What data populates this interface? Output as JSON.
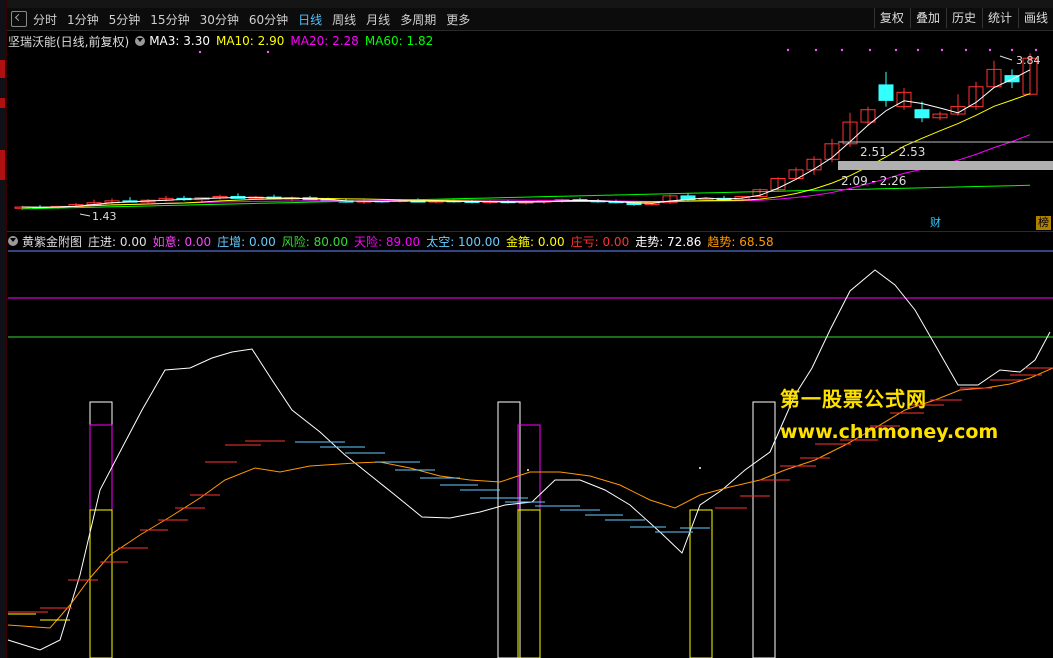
{
  "toolbar": {
    "periods": [
      "分时",
      "1分钟",
      "5分钟",
      "15分钟",
      "30分钟",
      "60分钟",
      "日线",
      "周线",
      "月线",
      "多周期",
      "更多"
    ],
    "active_period": "日线",
    "right_buttons": [
      "复权",
      "叠加",
      "历史",
      "统计",
      "画线"
    ]
  },
  "main_panel": {
    "title": "坚瑞沃能(日线,前复权)",
    "indicators": [
      {
        "label": "MA3: 3.30",
        "color": "#ffffff"
      },
      {
        "label": "MA10: 2.90",
        "color": "#ffff00"
      },
      {
        "label": "MA20: 2.28",
        "color": "#ff00ff"
      },
      {
        "label": "MA60: 1.82",
        "color": "#00ff00"
      }
    ],
    "high_label": "3.84",
    "low_label": "1.43",
    "range_label_1": "2.51 - 2.53",
    "range_label_2": "2.09 - 2.26",
    "badge_cai": "财",
    "badge_bang": "榜"
  },
  "sub_panel": {
    "title": "黄紫金附图",
    "indicators": [
      {
        "label": "庄进: 0.00",
        "color": "#e0e0e0"
      },
      {
        "label": "如意: 0.00",
        "color": "#ff44ff"
      },
      {
        "label": "庄增: 0.00",
        "color": "#66ccff"
      },
      {
        "label": "风险: 80.00",
        "color": "#33dd33"
      },
      {
        "label": "天险: 89.00",
        "color": "#ff00ff"
      },
      {
        "label": "太空: 100.00",
        "color": "#66ccff"
      },
      {
        "label": "金箍: 0.00",
        "color": "#ffff00"
      },
      {
        "label": "庄亏: 0.00",
        "color": "#ff3333"
      },
      {
        "label": "走势: 72.86",
        "color": "#ffffff"
      },
      {
        "label": "趋势: 68.58",
        "color": "#ff9900"
      }
    ]
  },
  "watermark": {
    "line1": "第一股票公式网",
    "line2": "www.chnmoney.com"
  },
  "colors": {
    "up_candle": "#ff3333",
    "down_candle": "#33ffff",
    "ma3": "#ffffff",
    "ma10": "#ffff00",
    "ma20": "#ff00ff",
    "ma60": "#00ff00",
    "trend": "#ff9900",
    "watermark": "#ffe100"
  }
}
